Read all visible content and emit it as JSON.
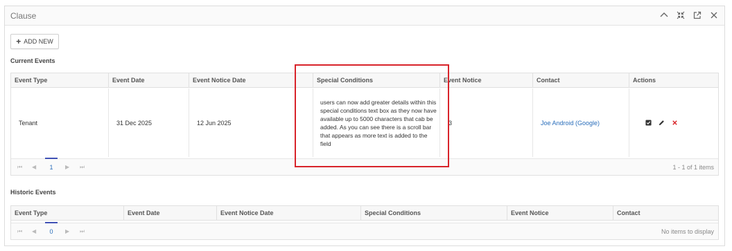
{
  "panel": {
    "title": "Clause",
    "header_icons": [
      "chevron-up-icon",
      "collapse-arrows-icon",
      "open-external-icon",
      "close-icon"
    ]
  },
  "toolbar": {
    "add_new_label": "ADD NEW",
    "add_new_icon": "+"
  },
  "current_events": {
    "title": "Current Events",
    "columns": [
      "Event Type",
      "Event Date",
      "Event Notice Date",
      "Special Conditions",
      "Event Notice",
      "Contact",
      "Actions"
    ],
    "rows": [
      {
        "event_type": "Tenant",
        "event_date": "31 Dec 2025",
        "event_notice_date": "12 Jun 2025",
        "special_conditions": "users can now add greater details within this special conditions text box as they now have available up to 5000 characters that cab be added. As you can see there is a scroll bar that appears as more text is added to the field",
        "event_notice": "3",
        "contact": "Joe Android (Google)",
        "action_icons": [
          "checkbox-icon",
          "pencil-icon",
          "delete-x-icon"
        ]
      }
    ],
    "pager": {
      "current_page": "1",
      "info": "1 - 1 of 1 items"
    }
  },
  "historic_events": {
    "title": "Historic Events",
    "columns": [
      "Event Type",
      "Event Date",
      "Event Notice Date",
      "Special Conditions",
      "Event Notice",
      "Contact"
    ],
    "pager": {
      "current_page": "0",
      "info": "No items to display"
    }
  },
  "pager_controls": {
    "first": "⏮",
    "prev": "◀",
    "next": "▶",
    "last": "⏭"
  },
  "colors": {
    "link": "#2a6ebb",
    "highlight": "#d8232a",
    "delete": "#d9262b",
    "page_indicator": "#3f51b5"
  }
}
